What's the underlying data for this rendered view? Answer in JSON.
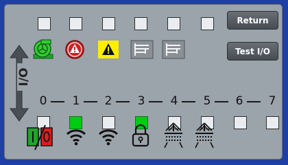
{
  "buttons": {
    "return_label": "Return",
    "test_io_label": "Test I/O"
  },
  "io_label": "I/O",
  "channels": {
    "numbers": [
      "0",
      "1",
      "2",
      "3",
      "4",
      "5",
      "6",
      "7"
    ],
    "states": [
      false,
      true,
      false,
      true,
      false,
      false,
      false,
      false
    ]
  },
  "icons": {
    "top_row": [
      "green-pump-icon",
      "red-alarm-icon",
      "yellow-warning-icon",
      "valve-grey-icon",
      "valve-grey-icon"
    ],
    "bottom_row": [
      "power-switch-icon",
      "wifi-icon",
      "wifi-icon",
      "lock-icon",
      "sensor-array-icon",
      "sensor-array-icon"
    ]
  },
  "colors": {
    "background": "#1e3fa3",
    "panel": "#9ba3ab",
    "active": "#00cc11",
    "alarm": "#cc2222",
    "warning": "#ffee00"
  }
}
